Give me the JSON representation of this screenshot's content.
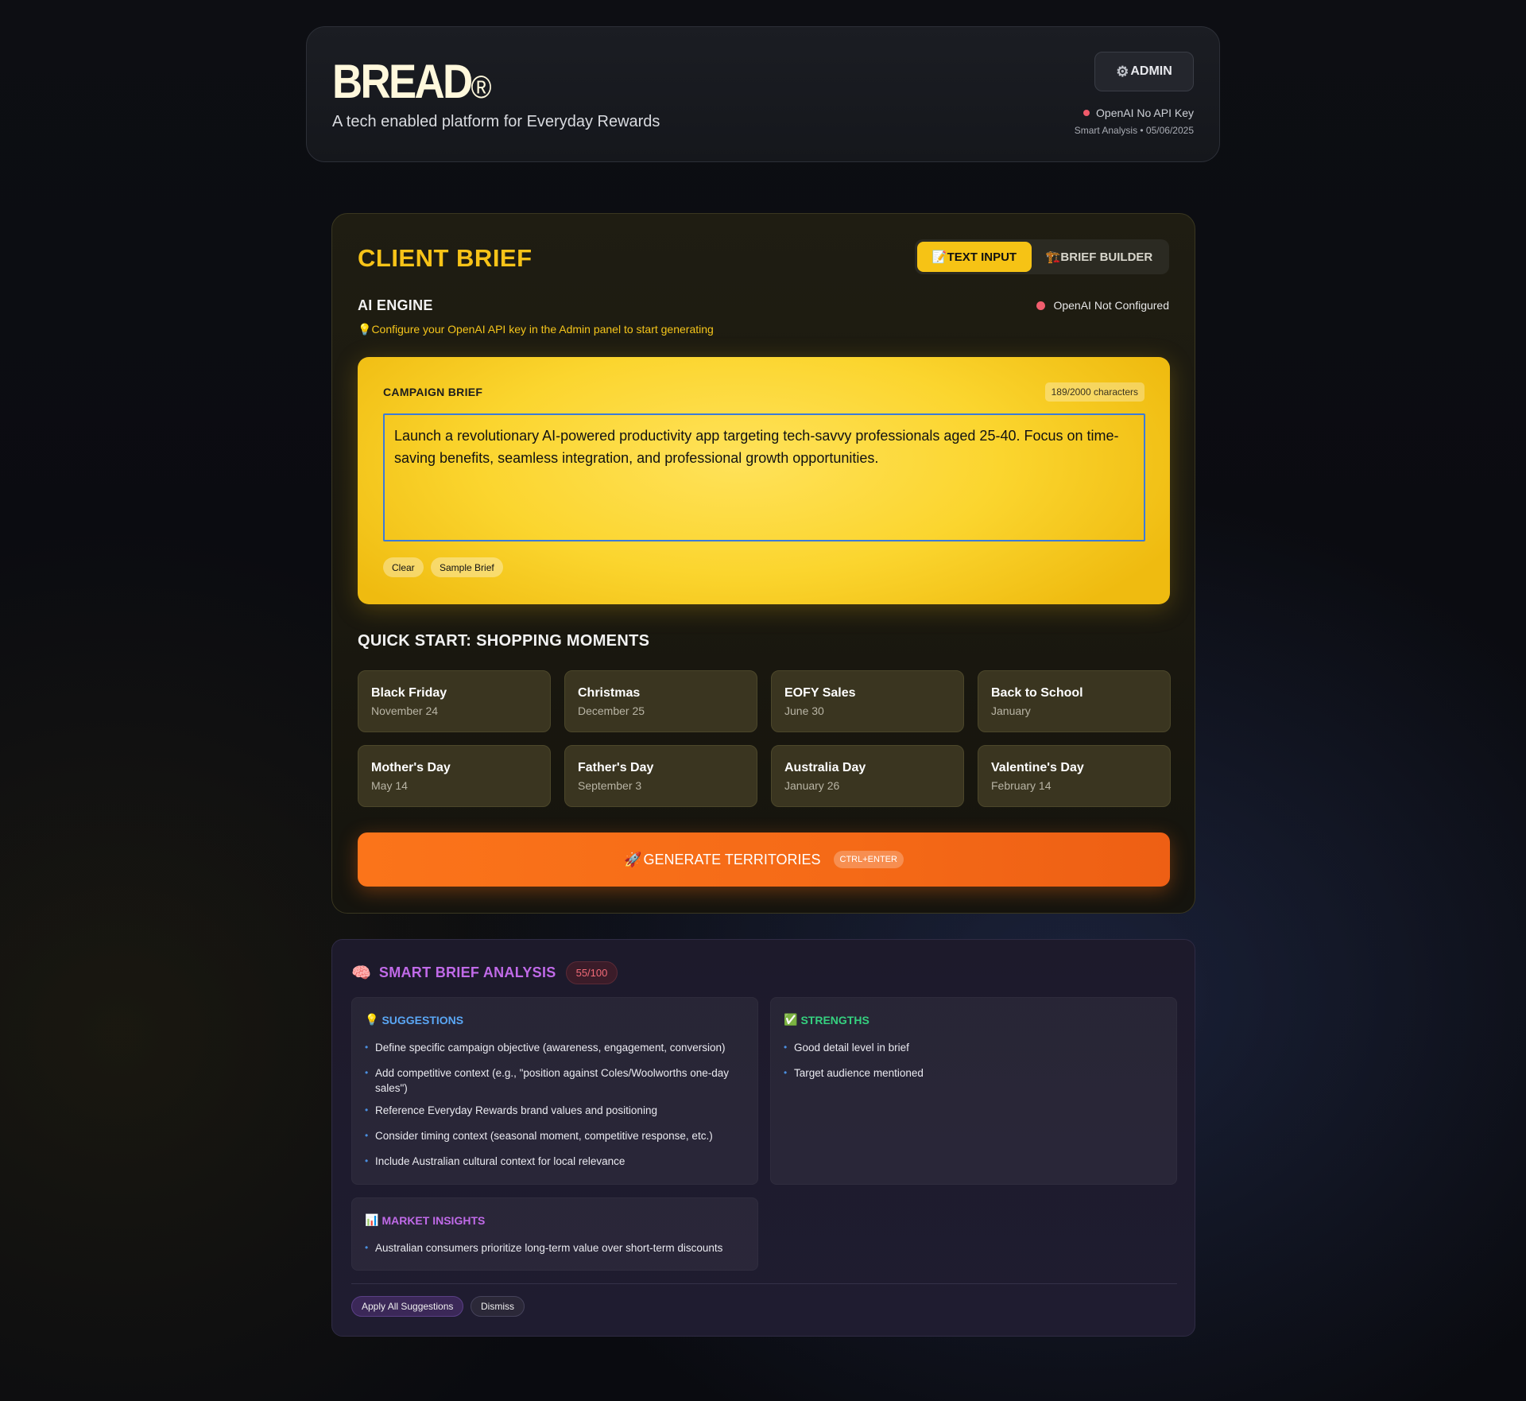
{
  "header": {
    "logo": "BREAD",
    "logo_mark": "®",
    "tagline": "A tech enabled platform for Everyday Rewards",
    "admin_label": "ADMIN",
    "admin_icon": "gear-icon",
    "api_status": "OpenAI No API Key",
    "smart_date": "Smart Analysis • 05/06/2025",
    "status_color": "#ef5a6a"
  },
  "brief": {
    "title": "CLIENT BRIEF",
    "tabs": [
      {
        "label": "TEXT INPUT",
        "icon": "📝",
        "active": true
      },
      {
        "label": "BRIEF BUILDER",
        "icon": "🏗️",
        "active": false
      }
    ],
    "ai_engine_label": "AI ENGINE",
    "ai_status": "OpenAI Not Configured",
    "ai_hint_icon": "💡",
    "ai_hint": "Configure your OpenAI API key in the Admin panel to start generating",
    "campaign": {
      "label": "CAMPAIGN BRIEF",
      "char_count": "189/2000 characters",
      "text": "Launch a revolutionary AI-powered productivity app targeting tech-savvy professionals aged 25-40. Focus on time-saving benefits, seamless integration, and professional growth opportunities.",
      "clear_label": "Clear",
      "sample_label": "Sample Brief"
    },
    "quick_start_title": "QUICK START: SHOPPING MOMENTS",
    "moments": [
      {
        "name": "Black Friday",
        "date": "November 24"
      },
      {
        "name": "Christmas",
        "date": "December 25"
      },
      {
        "name": "EOFY Sales",
        "date": "June 30"
      },
      {
        "name": "Back to School",
        "date": "January"
      },
      {
        "name": "Mother's Day",
        "date": "May 14"
      },
      {
        "name": "Father's Day",
        "date": "September 3"
      },
      {
        "name": "Australia Day",
        "date": "January 26"
      },
      {
        "name": "Valentine's Day",
        "date": "February 14"
      }
    ],
    "generate_icon": "🚀",
    "generate_label": "GENERATE TERRITORIES",
    "generate_shortcut": "CTRL+ENTER",
    "accent_color": "#f7c318"
  },
  "analysis": {
    "icon": "🧠",
    "title": "SMART BRIEF ANALYSIS",
    "score": "55/100",
    "suggestions": {
      "icon": "💡",
      "title": "SUGGESTIONS",
      "items": [
        "Define specific campaign objective (awareness, engagement, conversion)",
        "Add competitive context (e.g., \"position against Coles/Woolworths one-day sales\")",
        "Reference Everyday Rewards brand values and positioning",
        "Consider timing context (seasonal moment, competitive response, etc.)",
        "Include Australian cultural context for local relevance"
      ]
    },
    "strengths": {
      "icon": "✅",
      "title": "STRENGTHS",
      "items": [
        "Good detail level in brief",
        "Target audience mentioned"
      ]
    },
    "market_insights": {
      "icon": "📊",
      "title": "MARKET INSIGHTS",
      "items": [
        "Australian consumers prioritize long-term value over short-term discounts"
      ]
    },
    "apply_label": "Apply All Suggestions",
    "dismiss_label": "Dismiss",
    "suggestions_color": "#5aa7f5",
    "strengths_color": "#35d07f",
    "insights_color": "#c06ae8"
  }
}
